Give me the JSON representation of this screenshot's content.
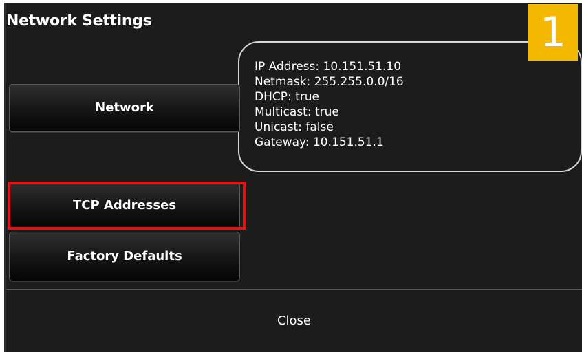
{
  "dialog": {
    "title": "Network Settings",
    "badge": "1",
    "info": {
      "ip_address": "IP Address: 10.151.51.10",
      "netmask": "Netmask: 255.255.0.0/16",
      "dhcp": "DHCP: true",
      "multicast": "Multicast: true",
      "unicast": "Unicast: false",
      "gateway": "Gateway: 10.151.51.1"
    },
    "buttons": {
      "network": "Network",
      "tcp_addresses": "TCP Addresses",
      "factory_defaults": "Factory Defaults"
    },
    "close_label": "Close",
    "colors": {
      "badge": "#f5b800",
      "highlight": "#e41212",
      "background": "#1c1c1c"
    }
  }
}
